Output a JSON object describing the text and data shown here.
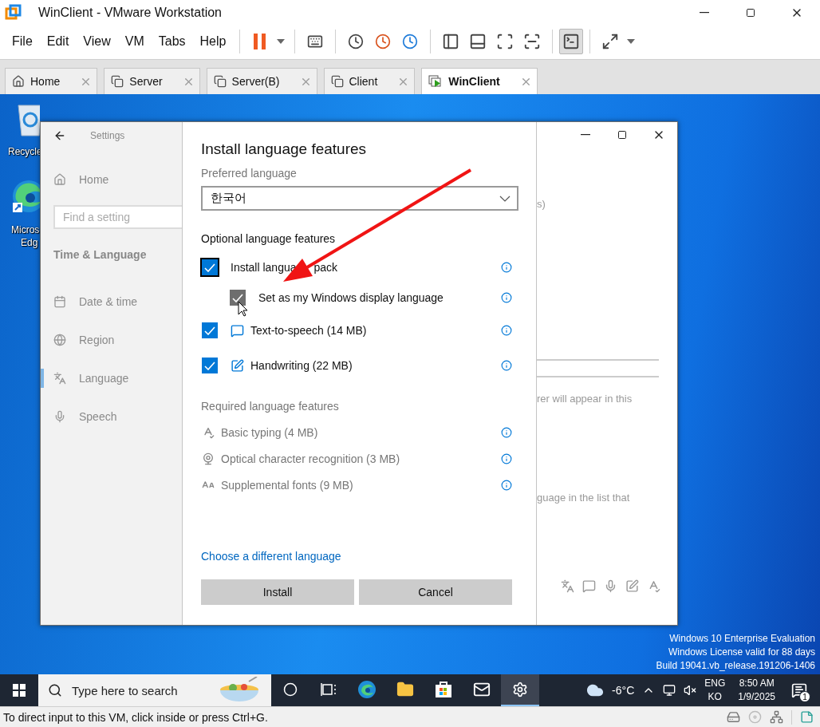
{
  "window": {
    "title": "WinClient - VMware Workstation"
  },
  "menu": [
    {
      "label": "File"
    },
    {
      "label": "Edit"
    },
    {
      "label": "View"
    },
    {
      "label": "VM"
    },
    {
      "label": "Tabs"
    },
    {
      "label": "Help"
    }
  ],
  "toolbar": [
    {
      "items": [
        {
          "kind": "pause",
          "pressed": false
        },
        {
          "kind": "caret",
          "pressed": false
        }
      ]
    },
    {
      "items": [
        {
          "kind": "send-keys",
          "pressed": false
        }
      ]
    },
    {
      "items": [
        {
          "kind": "snapshot",
          "pressed": false
        },
        {
          "kind": "revert",
          "pressed": false
        },
        {
          "kind": "manage",
          "pressed": false
        }
      ]
    },
    {
      "items": [
        {
          "kind": "sidebar",
          "pressed": false
        },
        {
          "kind": "thumbs",
          "pressed": false
        },
        {
          "kind": "full-view",
          "pressed": false
        },
        {
          "kind": "unity",
          "pressed": false
        }
      ]
    },
    {
      "items": [
        {
          "kind": "console",
          "pressed": true
        }
      ]
    },
    {
      "items": [
        {
          "kind": "fullscreen",
          "pressed": false
        },
        {
          "kind": "caret",
          "pressed": false
        }
      ]
    }
  ],
  "tabs": [
    {
      "label": "Home",
      "kind": "home",
      "selected": false
    },
    {
      "label": "Server",
      "kind": "vm",
      "selected": false
    },
    {
      "label": "Server(B)",
      "kind": "vm",
      "selected": false
    },
    {
      "label": "Client",
      "kind": "vm",
      "selected": false
    },
    {
      "label": "WinClient",
      "kind": "running",
      "selected": true
    }
  ],
  "desktop": {
    "icons": [
      {
        "kind": "recycle-bin",
        "lines": [
          "Recycle"
        ]
      },
      {
        "kind": "edge",
        "lines": [
          "Micros",
          "Edg"
        ]
      }
    ],
    "watermark": [
      "Windows 10 Enterprise Evaluation",
      "Windows License valid for 88 days",
      "Build 19041.vb_release.191206-1406"
    ]
  },
  "settings": {
    "title": "Settings",
    "home": "Home",
    "search_placeholder": "Find a setting",
    "section": "Time & Language",
    "nav": [
      {
        "label": "Date & time",
        "kind": "date-time",
        "selected": false
      },
      {
        "label": "Region",
        "kind": "region",
        "selected": false
      },
      {
        "label": "Language",
        "kind": "language",
        "selected": true
      },
      {
        "label": "Speech",
        "kind": "speech",
        "selected": false
      }
    ],
    "partial_texts": [
      "s)",
      "rer will appear in this",
      "guage in the list that"
    ]
  },
  "dialog": {
    "title": "Install language features",
    "preferred_label": "Preferred language",
    "preferred_value": "한국어",
    "optional_heading": "Optional language features",
    "optional": [
      {
        "label": "Install langua",
        "label_tail": "pack",
        "kind": "plain",
        "checked": true,
        "focused": true,
        "pressed": false,
        "children": [
          {
            "label": "Set as my Windows display language",
            "checked": true,
            "focused": false,
            "pressed": true
          }
        ]
      },
      {
        "label": "Text-to-speech (14 MB)",
        "kind": "speech",
        "checked": true,
        "focused": false,
        "pressed": false
      },
      {
        "label": "Handwriting (22 MB)",
        "kind": "handwriting",
        "checked": true,
        "focused": false,
        "pressed": false
      }
    ],
    "required_heading": "Required language features",
    "required": [
      {
        "label": "Basic typing (4 MB)",
        "kind": "typing"
      },
      {
        "label": "Optical character recognition (3 MB)",
        "kind": "ocr"
      },
      {
        "label": "Supplemental fonts (9 MB)",
        "kind": "fonts"
      }
    ],
    "link": "Choose a different language",
    "buttons": [
      "Install",
      "Cancel"
    ]
  },
  "taskbar": {
    "search_placeholder": "Type here to search",
    "apps": [
      {
        "kind": "cortana",
        "active": false
      },
      {
        "kind": "task-view",
        "active": false
      },
      {
        "kind": "edge",
        "active": false
      },
      {
        "kind": "explorer",
        "active": false
      },
      {
        "kind": "store",
        "active": false
      },
      {
        "kind": "mail",
        "active": false
      },
      {
        "kind": "settings",
        "active": true
      }
    ],
    "temperature": "-6°C",
    "input_lang": "ENG",
    "input_mode": "KO",
    "time": "8:50 AM",
    "date": "1/9/2025",
    "notifications": "1"
  },
  "status_bar": {
    "text": "To direct input to this VM, click inside or press Ctrl+G."
  }
}
